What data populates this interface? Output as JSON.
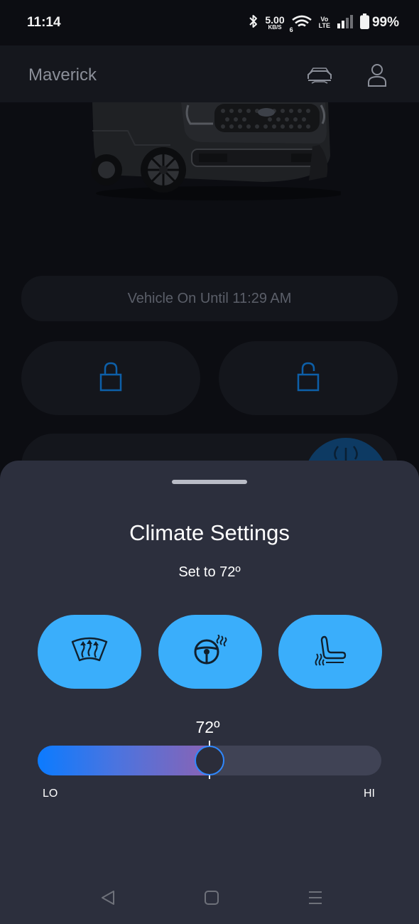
{
  "status_bar": {
    "time": "11:14",
    "net_speed_value": "5.00",
    "net_speed_unit": "KB/S",
    "wifi_badge": "6",
    "volte_top": "Vo",
    "volte_bottom": "LTE",
    "battery": "99%",
    "icons": [
      "bluetooth-icon",
      "wifi-icon",
      "signal-icon",
      "battery-icon"
    ]
  },
  "header": {
    "title": "Maverick",
    "icons": [
      "vehicle-icon",
      "profile-icon"
    ]
  },
  "vehicle_status": {
    "text": "Vehicle On Until 11:29 AM"
  },
  "controls": {
    "icons": [
      "lock-icon",
      "unlock-icon",
      "power-icon"
    ]
  },
  "climate_sheet": {
    "title": "Climate Settings",
    "subtitle": "Set to 72º",
    "feature_icons": [
      "front-defrost-icon",
      "heated-steering-wheel-icon",
      "heated-seat-icon"
    ],
    "temperature_display": "72º",
    "slider_level": 0.5,
    "min_label": "LO",
    "max_label": "HI"
  },
  "nav_bar": {
    "icons": [
      "back-icon",
      "home-icon",
      "menu-icon"
    ]
  },
  "colors": {
    "accent": "#3aaefb",
    "sheet_background": "#2c2f3d",
    "page_background": "#0c0d12"
  }
}
